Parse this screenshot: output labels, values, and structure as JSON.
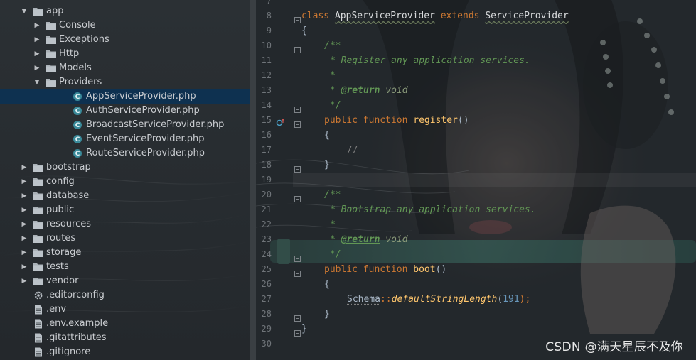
{
  "tree": {
    "items": [
      {
        "label": "app",
        "kind": "folder",
        "arrow": "▼",
        "depth": 0
      },
      {
        "label": "Console",
        "kind": "folder",
        "arrow": "▶",
        "depth": 1
      },
      {
        "label": "Exceptions",
        "kind": "folder",
        "arrow": "▶",
        "depth": 1
      },
      {
        "label": "Http",
        "kind": "folder",
        "arrow": "▶",
        "depth": 1
      },
      {
        "label": "Models",
        "kind": "folder",
        "arrow": "▶",
        "depth": 1
      },
      {
        "label": "Providers",
        "kind": "folder",
        "arrow": "▼",
        "depth": 1
      },
      {
        "label": "AppServiceProvider.php",
        "kind": "class",
        "arrow": "",
        "depth": 2,
        "selected": true
      },
      {
        "label": "AuthServiceProvider.php",
        "kind": "class",
        "arrow": "",
        "depth": 2
      },
      {
        "label": "BroadcastServiceProvider.php",
        "kind": "class",
        "arrow": "",
        "depth": 2
      },
      {
        "label": "EventServiceProvider.php",
        "kind": "class",
        "arrow": "",
        "depth": 2
      },
      {
        "label": "RouteServiceProvider.php",
        "kind": "class",
        "arrow": "",
        "depth": 2
      },
      {
        "label": "bootstrap",
        "kind": "folder",
        "arrow": "▶",
        "depth": 0
      },
      {
        "label": "config",
        "kind": "folder",
        "arrow": "▶",
        "depth": 0
      },
      {
        "label": "database",
        "kind": "folder",
        "arrow": "▶",
        "depth": 0
      },
      {
        "label": "public",
        "kind": "folder",
        "arrow": "▶",
        "depth": 0
      },
      {
        "label": "resources",
        "kind": "folder",
        "arrow": "▶",
        "depth": 0
      },
      {
        "label": "routes",
        "kind": "folder",
        "arrow": "▶",
        "depth": 0
      },
      {
        "label": "storage",
        "kind": "folder",
        "arrow": "▶",
        "depth": 0
      },
      {
        "label": "tests",
        "kind": "folder",
        "arrow": "▶",
        "depth": 0
      },
      {
        "label": "vendor",
        "kind": "folder",
        "arrow": "▶",
        "depth": 0
      },
      {
        "label": ".editorconfig",
        "kind": "gear",
        "arrow": "",
        "depth": 0
      },
      {
        "label": ".env",
        "kind": "file",
        "arrow": "",
        "depth": 0
      },
      {
        "label": ".env.example",
        "kind": "file",
        "arrow": "",
        "depth": 0
      },
      {
        "label": ".gitattributes",
        "kind": "file",
        "arrow": "",
        "depth": 0
      },
      {
        "label": ".gitignore",
        "kind": "file",
        "arrow": "",
        "depth": 0
      }
    ]
  },
  "editor": {
    "line_numbers": [
      "7",
      "8",
      "9",
      "10",
      "11",
      "12",
      "13",
      "14",
      "15",
      "16",
      "17",
      "18",
      "19",
      "20",
      "21",
      "22",
      "23",
      "24",
      "25",
      "26",
      "27",
      "28",
      "29",
      "30"
    ],
    "line_8": {
      "k1": "class",
      "name": "AppServiceProvider",
      "k2": "extends",
      "parent": "ServiceProvider"
    },
    "line_9": "{",
    "line_10": "/**",
    "line_11": "* Register any application services.",
    "line_12": "*",
    "line_13": {
      "star": "*",
      "tag": "@return",
      "type": "void"
    },
    "line_14": "*/",
    "line_15": {
      "k1": "public",
      "k2": "function",
      "fn": "register",
      "paren": "()"
    },
    "line_16": "{",
    "line_17": "//",
    "line_18": "}",
    "line_20": "/**",
    "line_21": "* Bootstrap any application services.",
    "line_22": "*",
    "line_23": {
      "star": "*",
      "tag": "@return",
      "type": "void"
    },
    "line_24": "*/",
    "line_25": {
      "k1": "public",
      "k2": "function",
      "fn": "boot",
      "paren": "()"
    },
    "line_26": "{",
    "line_27": {
      "cls": "Schema",
      "sep": "::",
      "call": "defaultStringLength",
      "open": "(",
      "num": "191",
      "close": ");"
    },
    "line_28": "}",
    "line_29": "}"
  },
  "watermark": "CSDN @满天星辰不及你",
  "colors": {
    "keyword": "#cc7832",
    "function": "#ffc66d",
    "comment": "#629755",
    "number": "#6897bb",
    "selection": "#0e3150"
  }
}
